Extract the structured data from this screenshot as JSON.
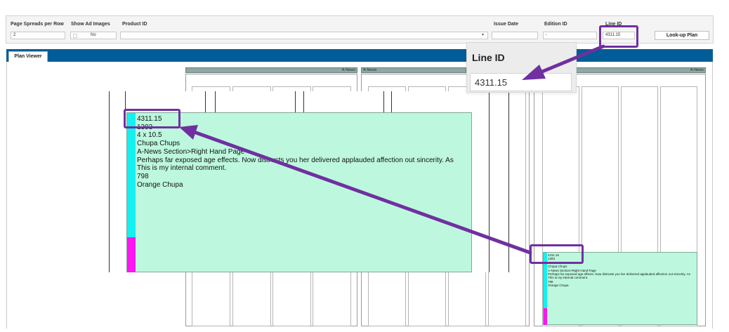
{
  "toolbar": {
    "page_spreads_label": "Page Spreads per Row",
    "page_spreads_value": "2",
    "show_ad_images_label": "Show Ad Images",
    "show_ad_images_value": "No",
    "product_id_label": "Product ID",
    "product_id_value": "",
    "issue_date_label": "Issue Date",
    "issue_date_value": "",
    "edition_id_label": "Edition ID",
    "edition_id_value": "-",
    "line_id_label": "Line ID",
    "line_id_value": "4311.15",
    "lookup_button": "Look-up Plan"
  },
  "viewer": {
    "tab_label": "Plan Viewer",
    "page_headers": [
      "A-News",
      "A-News",
      "A-News"
    ]
  },
  "ad_zoomed": {
    "lines": [
      "4311.15",
      "1393",
      "4 x 10.5",
      "Chupa Chups",
      "A-News Section>Right Hand Page",
      "Perhaps far exposed age effects. Now distrusts you her delivered applauded affection out sincerity. As",
      "This is my internal comment.",
      "798",
      "Orange Chupa"
    ]
  },
  "ad_small": {
    "lines": [
      "4311.15",
      "1393",
      "",
      "Chupa Chups",
      "A-News Section>Right Hand Page",
      "Perhaps far exposed age effects. Now distrusts you her delivered applauded affection out sincerity. As",
      "This is my internal comment.",
      "798",
      "Orange Chupa"
    ]
  },
  "callout": {
    "title": "Line ID",
    "value": "4311.15"
  },
  "colors": {
    "accent_tab_bar": "#005d97",
    "ad_fill": "#bdf8de",
    "highlight": "#7030a0",
    "cyan_bar": "#13f0ef",
    "magenta_bar": "#ff16f0"
  }
}
